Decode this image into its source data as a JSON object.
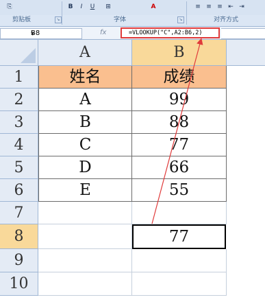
{
  "ribbon": {
    "groups": [
      {
        "label": "剪贴板"
      },
      {
        "label": "字体"
      },
      {
        "label": "对齐方式"
      }
    ]
  },
  "formula_bar": {
    "name_box": "B8",
    "fx_symbol": "fx",
    "formula": "=VLOOKUP(\"C\",A2:B6,2)"
  },
  "sheet": {
    "columns": [
      "A",
      "B"
    ],
    "rows": [
      {
        "num": "1",
        "a": "姓名",
        "b": "成绩"
      },
      {
        "num": "2",
        "a": "A",
        "b": "99"
      },
      {
        "num": "3",
        "a": "B",
        "b": "88"
      },
      {
        "num": "4",
        "a": "C",
        "b": "77"
      },
      {
        "num": "5",
        "a": "D",
        "b": "66"
      },
      {
        "num": "6",
        "a": "E",
        "b": "55"
      },
      {
        "num": "7",
        "a": "",
        "b": ""
      },
      {
        "num": "8",
        "a": "",
        "b": "77"
      },
      {
        "num": "9",
        "a": "",
        "b": ""
      },
      {
        "num": "10",
        "a": "",
        "b": ""
      }
    ],
    "active_cell": "B8"
  },
  "colors": {
    "header_fill": "#fabf8f",
    "selected_header": "#f9d99a",
    "annotation_red": "#e03a3a"
  }
}
